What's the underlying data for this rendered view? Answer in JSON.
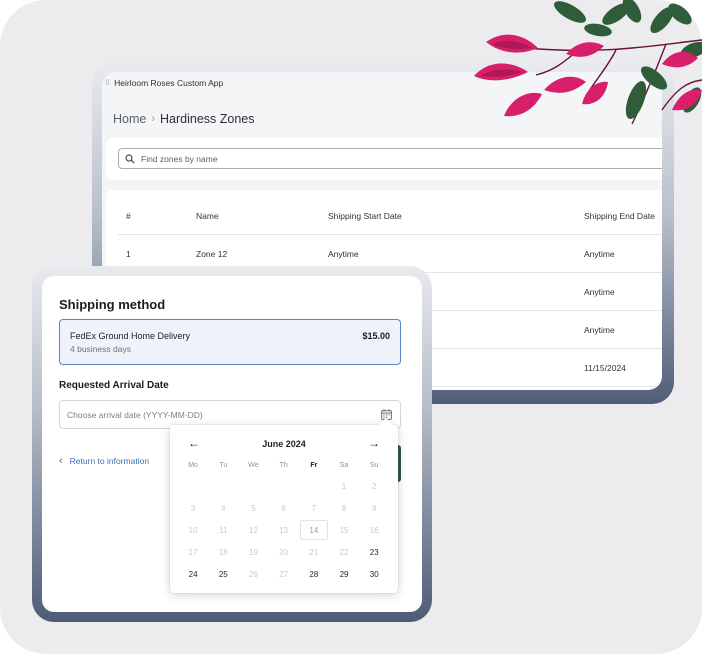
{
  "admin_app": {
    "window_title": "Heirloom Roses Custom App",
    "breadcrumb": {
      "home": "Home",
      "separator": "›",
      "current": "Hardiness Zones"
    },
    "search": {
      "placeholder": "Find zones by name",
      "icon": "search-icon"
    },
    "table": {
      "headers": [
        "#",
        "Name",
        "Shipping Start Date",
        "Shipping End Date"
      ],
      "rows": [
        [
          "1",
          "Zone 12",
          "Anytime",
          "Anytime"
        ],
        [
          "",
          "",
          "",
          "Anytime"
        ],
        [
          "",
          "",
          "",
          "Anytime"
        ],
        [
          "",
          "",
          "",
          "11/15/2024"
        ]
      ]
    }
  },
  "checkout": {
    "shipping_title": "Shipping method",
    "option": {
      "name": "FedEx Ground Home Delivery",
      "eta": "4 business days",
      "price": "$15.00"
    },
    "arrival_label": "Requested Arrival Date",
    "date_placeholder": "Choose arrival date (YYYY-MM-DD)",
    "date_icon": "calendar-icon",
    "return_link": "Return to information"
  },
  "calendar": {
    "month": "June 2024",
    "prev_icon": "arrow-left-icon",
    "next_icon": "arrow-right-icon",
    "weekdays": [
      "Mo",
      "Tu",
      "We",
      "Th",
      "Fr",
      "Sa",
      "Su"
    ],
    "highlight_weekday": "Fr",
    "today": "14",
    "weeks": [
      [
        {
          "d": ""
        },
        {
          "d": ""
        },
        {
          "d": ""
        },
        {
          "d": ""
        },
        {
          "d": ""
        },
        {
          "d": "1",
          "on": false
        },
        {
          "d": "2",
          "on": false
        }
      ],
      [
        {
          "d": "3",
          "on": false
        },
        {
          "d": "4",
          "on": false
        },
        {
          "d": "5",
          "on": false
        },
        {
          "d": "6",
          "on": false
        },
        {
          "d": "7",
          "on": false
        },
        {
          "d": "8",
          "on": false
        },
        {
          "d": "9",
          "on": false
        }
      ],
      [
        {
          "d": "10",
          "on": false
        },
        {
          "d": "11",
          "on": false
        },
        {
          "d": "12",
          "on": false
        },
        {
          "d": "13",
          "on": false
        },
        {
          "d": "14",
          "on": false
        },
        {
          "d": "15",
          "on": false
        },
        {
          "d": "16",
          "on": false
        }
      ],
      [
        {
          "d": "17",
          "on": false
        },
        {
          "d": "18",
          "on": false
        },
        {
          "d": "19",
          "on": false
        },
        {
          "d": "20",
          "on": false
        },
        {
          "d": "21",
          "on": false
        },
        {
          "d": "22",
          "on": false
        },
        {
          "d": "23",
          "on": true
        }
      ],
      [
        {
          "d": "24",
          "on": true
        },
        {
          "d": "25",
          "on": true
        },
        {
          "d": "26",
          "on": false
        },
        {
          "d": "27",
          "on": false
        },
        {
          "d": "28",
          "on": true
        },
        {
          "d": "29",
          "on": true
        },
        {
          "d": "30",
          "on": true
        }
      ]
    ]
  },
  "colors": {
    "accent_blue": "#5a86c7",
    "link_blue": "#3d6fb4",
    "button_green": "#2f5a4a",
    "device_frame_dark": "#4e5c77"
  }
}
